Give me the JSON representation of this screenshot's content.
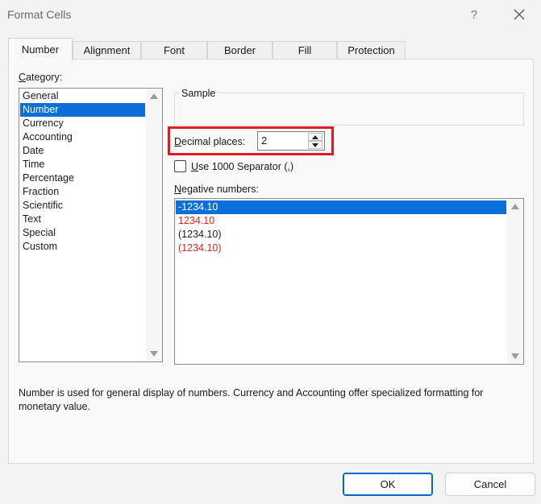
{
  "dialog": {
    "title": "Format Cells",
    "help_label": "?"
  },
  "tabs": [
    {
      "label": "Number",
      "active": true
    },
    {
      "label": "Alignment"
    },
    {
      "label": "Font"
    },
    {
      "label": "Border"
    },
    {
      "label": "Fill"
    },
    {
      "label": "Protection"
    }
  ],
  "category": {
    "label_first": "C",
    "label_rest": "ategory:",
    "items": [
      "General",
      "Number",
      "Currency",
      "Accounting",
      "Date",
      "Time",
      "Percentage",
      "Fraction",
      "Scientific",
      "Text",
      "Special",
      "Custom"
    ],
    "selected": "Number"
  },
  "sample": {
    "label": "Sample",
    "value": ""
  },
  "decimal_places": {
    "label_first": "D",
    "label_rest": "ecimal places:",
    "value": "2"
  },
  "separator": {
    "label_first": "U",
    "label_rest": "se 1000 Separator (,)",
    "checked": false
  },
  "negative_numbers": {
    "label_first": "N",
    "label_rest": "egative numbers:",
    "items": [
      {
        "text": "-1234.10",
        "color": "#000000",
        "selected": true
      },
      {
        "text": "1234.10",
        "color": "#e02020"
      },
      {
        "text": "(1234.10)",
        "color": "#000000"
      },
      {
        "text": "(1234.10)",
        "color": "#e02020"
      }
    ]
  },
  "description": "Number is used for general display of numbers.  Currency and Accounting offer specialized formatting for monetary value.",
  "buttons": {
    "ok": "OK",
    "cancel": "Cancel"
  },
  "colors": {
    "selection": "#0a6fd8",
    "highlight_border": "#e11b24",
    "ok_border": "#0067c0"
  }
}
